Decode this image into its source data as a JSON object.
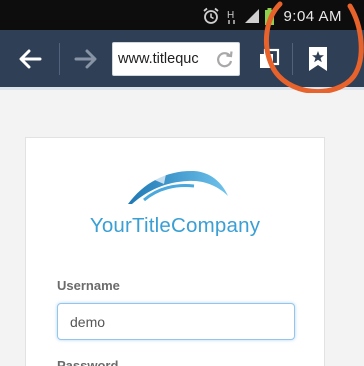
{
  "status_bar": {
    "time": "9:04 AM",
    "icons": [
      "alarm-icon",
      "signal-h-icon",
      "signal-strength-icon",
      "battery-icon"
    ]
  },
  "browser": {
    "url": "www.titlequc",
    "icons": [
      "back-arrow-icon",
      "forward-arrow-icon",
      "reload-icon",
      "tabs-icon",
      "bookmark-icon"
    ]
  },
  "page": {
    "brand_name": "YourTitleCompany",
    "username_label": "Username",
    "username_value": "demo",
    "password_label": "Password"
  },
  "colors": {
    "toolbar": "#2e3f56",
    "brand": "#3a9fd4",
    "annotation": "#e8622c"
  }
}
